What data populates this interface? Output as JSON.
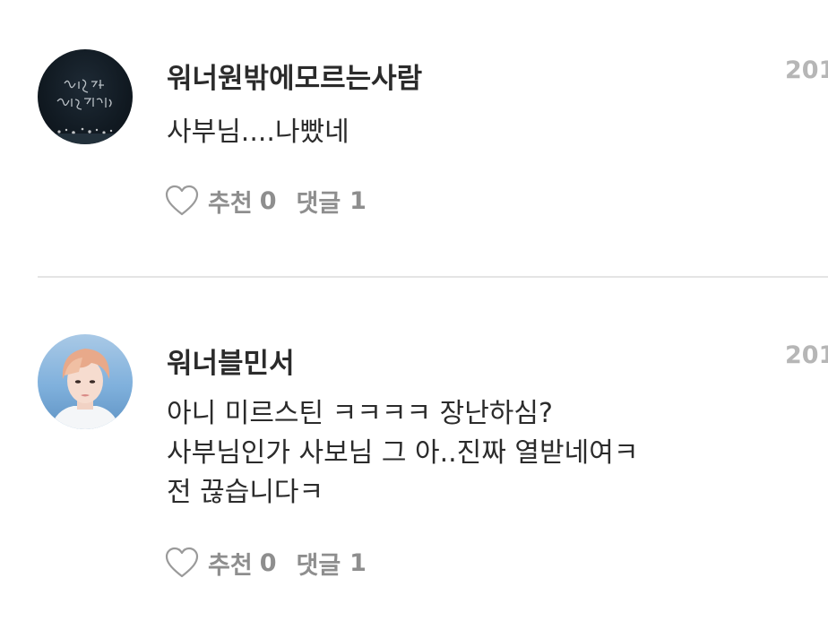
{
  "comments": [
    {
      "username": "워너원밖에모르는사람",
      "date": "201",
      "avatar_text": "너의 추억, 너의 기억에서",
      "body_lines": [
        "사부님....나빴네"
      ],
      "like_label": "추천",
      "like_count": "0",
      "reply_label": "댓글",
      "reply_count": "1"
    },
    {
      "username": "워너블민서",
      "date": "201",
      "body_lines": [
        "아니 미르스틴 ㅋㅋㅋㅋ 장난하심?",
        "사부님인가 사보님 그 아..진짜 열받네여ㅋ",
        "전 끊습니다ㅋ"
      ],
      "like_label": "추천",
      "like_count": "0",
      "reply_label": "댓글",
      "reply_count": "1"
    }
  ],
  "colors": {
    "username": "#2b2b2b",
    "body": "#2b2b2b",
    "meta": "#8e8e8e",
    "date": "#b6b6b6",
    "divider": "#e4e4e4"
  },
  "icons": {
    "like": "heart-outline-icon"
  }
}
